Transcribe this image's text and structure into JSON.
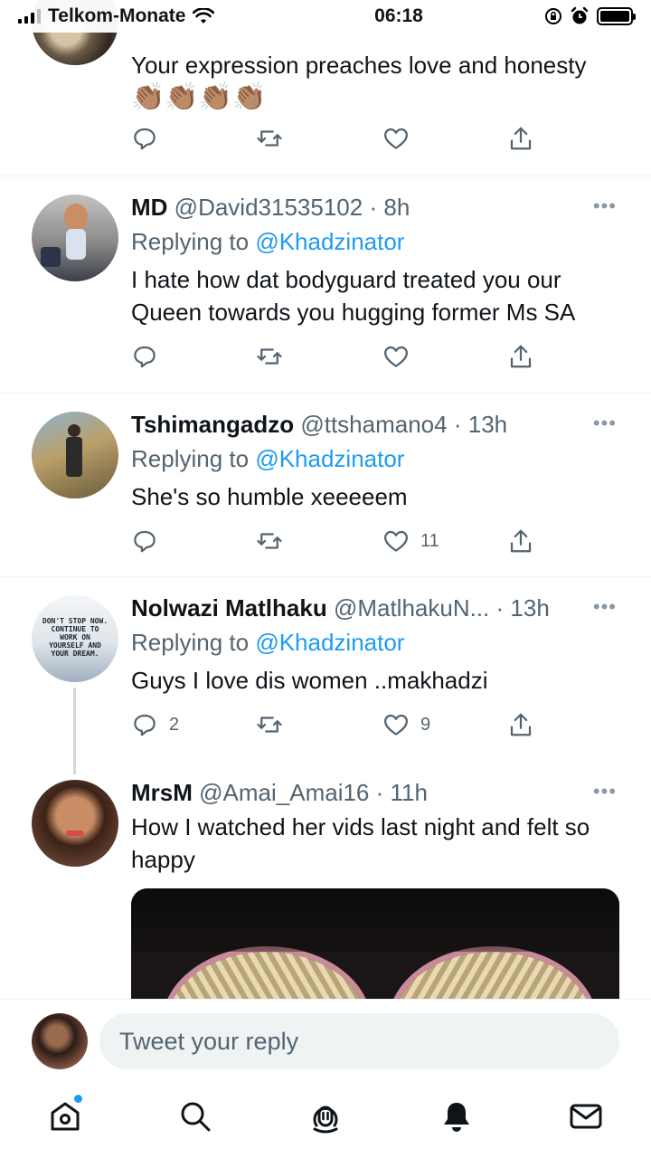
{
  "status_bar": {
    "carrier": "Telkom-Monate",
    "time": "06:18"
  },
  "tweets": [
    {
      "text": "Your expression preaches love and honesty",
      "emoji": "👏🏽👏🏽👏🏽👏🏽",
      "replies": "",
      "likes": ""
    },
    {
      "name": "MD",
      "handle": "@David31535102",
      "time": "8h",
      "replying_label": "Replying to",
      "replying_to": "@Khadzinator",
      "text": "I hate how dat bodyguard treated you our Queen towards you hugging former Ms SA",
      "replies": "",
      "likes": ""
    },
    {
      "name": "Tshimangadzo",
      "handle": "@ttshamano4",
      "time": "13h",
      "replying_label": "Replying to",
      "replying_to": "@Khadzinator",
      "text": "She's so humble xeeeeem",
      "replies": "",
      "likes": "11"
    },
    {
      "name": "Nolwazi Matlhaku",
      "handle": "@MatlhakuN...",
      "time": "13h",
      "replying_label": "Replying to",
      "replying_to": "@Khadzinator",
      "text": "Guys I love dis women ..makhadzi",
      "replies": "2",
      "likes": "9",
      "avatar_text": "DON'T STOP NOW. CONTINUE TO WORK ON YOURSELF AND YOUR DREAM."
    },
    {
      "name": "MrsM",
      "handle": "@Amai_Amai16",
      "time": "11h",
      "text": "How I watched her vids last night and felt so happy"
    }
  ],
  "separator": "·",
  "more_glyph": "•••",
  "reply_bar": {
    "placeholder": "Tweet your reply"
  },
  "tab_bar": {
    "icons": [
      "home-icon",
      "search-icon",
      "spaces-icon",
      "notifications-icon",
      "messages-icon"
    ]
  },
  "colors": {
    "accent": "#1d9bf0",
    "secondary_text": "#536471",
    "divider": "#eff3f4"
  }
}
